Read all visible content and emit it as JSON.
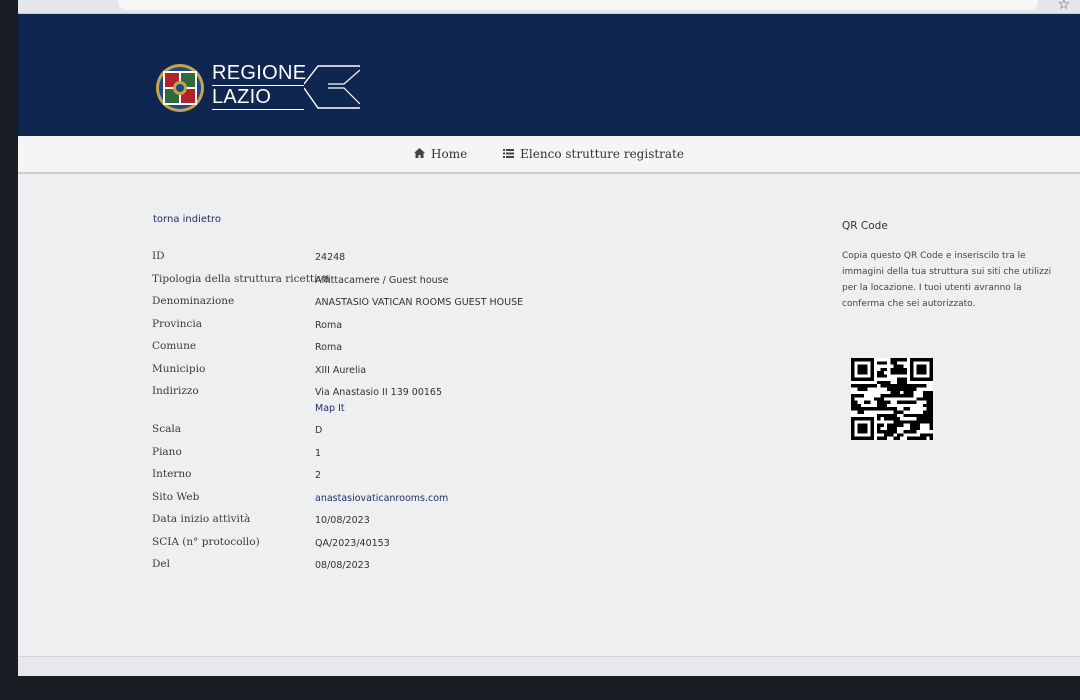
{
  "header": {
    "logo_line1": "REGIONE",
    "logo_line2": "LAZIO",
    "brand_color": "#0f2750"
  },
  "nav": {
    "items": [
      {
        "label": "Home",
        "icon": "home-icon"
      },
      {
        "label": "Elenco strutture registrate",
        "icon": "list-icon"
      }
    ]
  },
  "page": {
    "back_link": "torna indietro",
    "fields": [
      {
        "label": "ID",
        "value": "24248"
      },
      {
        "label": "Tipologia della struttura ricettiva",
        "value": "Affittacamere / Guest house"
      },
      {
        "label": "Denominazione",
        "value": "ANASTASIO VATICAN ROOMS GUEST HOUSE"
      },
      {
        "label": "Provincia",
        "value": "Roma"
      },
      {
        "label": "Comune",
        "value": "Roma"
      },
      {
        "label": "Municipio",
        "value": "XIII Aurelia"
      },
      {
        "label": "Indirizzo",
        "value": "Via Anastasio II 139 00165",
        "link": "Map It"
      },
      {
        "label": "Scala",
        "value": "D"
      },
      {
        "label": "Piano",
        "value": "1"
      },
      {
        "label": "Interno",
        "value": "2"
      },
      {
        "label": "Sito Web",
        "value": "anastasiovaticanrooms.com"
      },
      {
        "label": "Data inizio attività",
        "value": "10/08/2023"
      },
      {
        "label": "SCIA (n° protocollo)",
        "value": "QA/2023/40153"
      },
      {
        "label": "Del",
        "value": "08/08/2023"
      }
    ]
  },
  "qr": {
    "title": "QR Code",
    "description": "Copia questo QR Code e inseriscilo tra le immagini della tua struttura sui siti che utilizzi per la locazione. I tuoi utenti avranno la conferma che sei autorizzato."
  }
}
